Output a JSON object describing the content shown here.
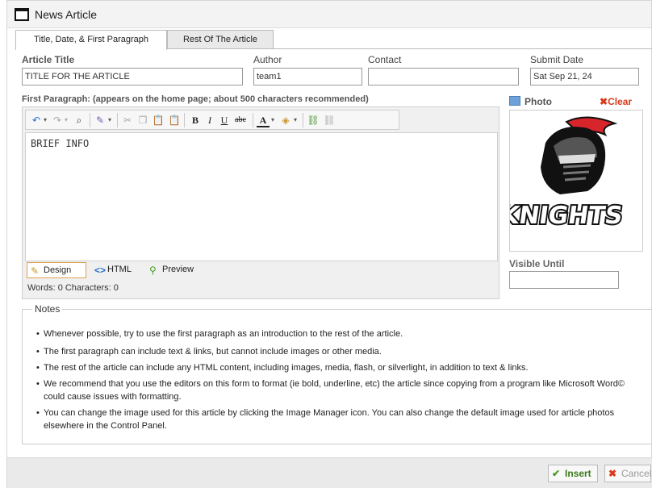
{
  "window": {
    "title": "News Article"
  },
  "tabs": [
    {
      "label": "Title, Date, & First Paragraph"
    },
    {
      "label": "Rest Of The Article"
    }
  ],
  "fields": {
    "article_title": {
      "label": "Article Title",
      "value": "TITLE FOR THE ARTICLE"
    },
    "author": {
      "label": "Author",
      "value": "team1"
    },
    "contact": {
      "label": "Contact",
      "value": ""
    },
    "submit_date": {
      "label": "Submit Date",
      "value": "Sat Sep 21, 24"
    }
  },
  "first_paragraph": {
    "label": "First Paragraph: (appears on the home page; about 500 characters recommended)",
    "content": "BRIEF INFO",
    "modes": [
      "Design",
      "HTML",
      "Preview"
    ],
    "word_count": "Words: 0  Characters: 0"
  },
  "photo": {
    "label": "Photo",
    "clear_label": "Clear",
    "logo_text": "KNIGHTS",
    "visible_until_label": "Visible Until",
    "visible_until_value": ""
  },
  "notes": {
    "legend": "Notes",
    "items": [
      "Whenever possible, try to use the first paragraph as an introduction to the rest of the article.",
      "The first paragraph can include text & links, but cannot include images or other media.",
      "The rest of the article can include any HTML content, including images, media, flash, or silverlight, in addition to text & links.",
      "We recommend that you use the editors on this form to format (ie bold, underline, etc) the article since copying from a program like Microsoft Word© could cause issues with formatting.",
      "You can change the image used for this article by clicking the Image Manager icon. You can also change the default image used for article photos elsewhere in the Control Panel."
    ]
  },
  "buttons": {
    "insert": "Insert",
    "cancel": "Cancel"
  },
  "colors": {
    "accent_orange": "#e0a050",
    "clear_red": "#d83a1a",
    "insert_green": "#4a9a2a"
  },
  "icons": [
    "window-icon",
    "undo-icon",
    "redo-icon",
    "find-icon",
    "format-icon",
    "cut-icon",
    "copy-icon",
    "paste-icon",
    "paste-text-icon",
    "bold-icon",
    "italic-icon",
    "underline-icon",
    "strikethrough-icon",
    "font-color-icon",
    "highlight-icon",
    "link-icon",
    "unlink-icon",
    "design-icon",
    "html-icon",
    "preview-icon",
    "photo-icon",
    "clear-icon",
    "check-icon",
    "cancel-icon"
  ]
}
